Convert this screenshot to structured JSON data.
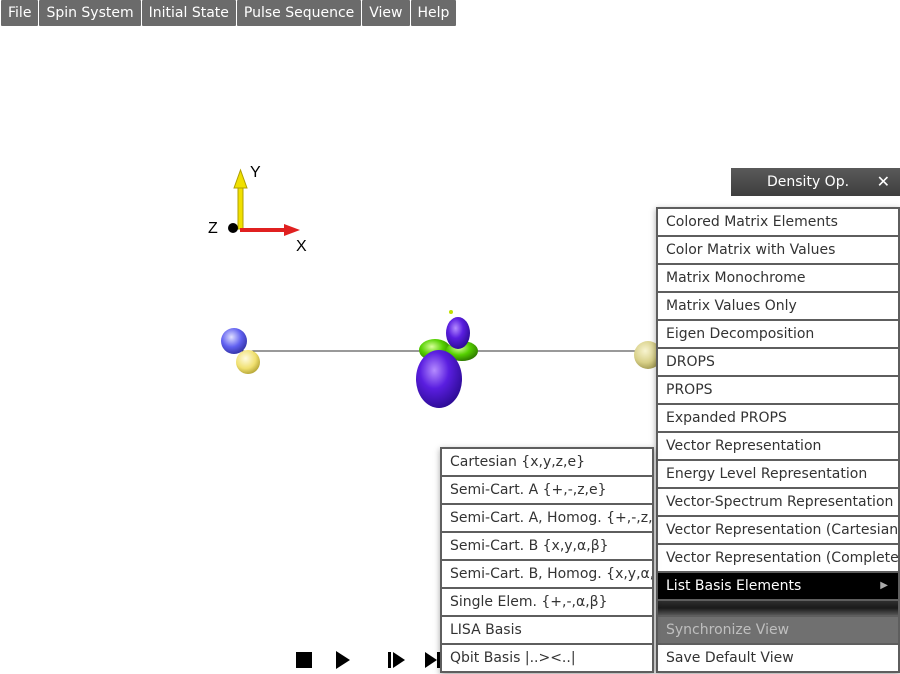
{
  "menubar": {
    "items": [
      {
        "label": "File"
      },
      {
        "label": "Spin System"
      },
      {
        "label": "Initial State"
      },
      {
        "label": "Pulse Sequence"
      },
      {
        "label": "View"
      },
      {
        "label": "Help"
      }
    ]
  },
  "axes": {
    "x_label": "X",
    "y_label": "Y",
    "z_label": "Z"
  },
  "density_panel": {
    "title": "Density Op.",
    "close_glyph": "✕"
  },
  "density_menu": {
    "items": [
      "Colored Matrix Elements",
      "Color Matrix with Values",
      "Matrix Monochrome",
      "Matrix Values Only",
      "Eigen Decomposition",
      "DROPS",
      "PROPS",
      "Expanded PROPS",
      "Vector Representation",
      "Energy Level Representation",
      "Vector-Spectrum Representation",
      "Vector Representation (Cartesian)",
      "Vector Representation (Complete)"
    ],
    "active_item": "List Basis Elements",
    "disabled_item": "Synchronize View",
    "last_item": "Save Default View"
  },
  "basis_submenu": {
    "items": [
      "Cartesian {x,y,z,e}",
      "Semi-Cart. A {+,-,z,e}",
      "Semi-Cart. A, Homog. {+,-,z,e}",
      "Semi-Cart. B {x,y,α,β}",
      "Semi-Cart. B, Homog. {x,y,α,β}",
      "Single Elem. {+,-,α,β}",
      "LISA Basis",
      "Qbit Basis |..><..|"
    ]
  },
  "playback": {
    "icons": [
      "stop-icon",
      "play-icon",
      "step-forward-icon",
      "skip-end-icon"
    ]
  },
  "colors": {
    "menu_bg": "#6b6b6b",
    "active_bg": "#000000",
    "disabled_bg": "#707070",
    "lobe_purple": "#5a1ee0",
    "lobe_green": "#55d000",
    "sphere_yellow": "#f0e070",
    "sphere_blue": "#6060f0",
    "axis_x": "#e02020",
    "axis_y": "#f0e000"
  }
}
